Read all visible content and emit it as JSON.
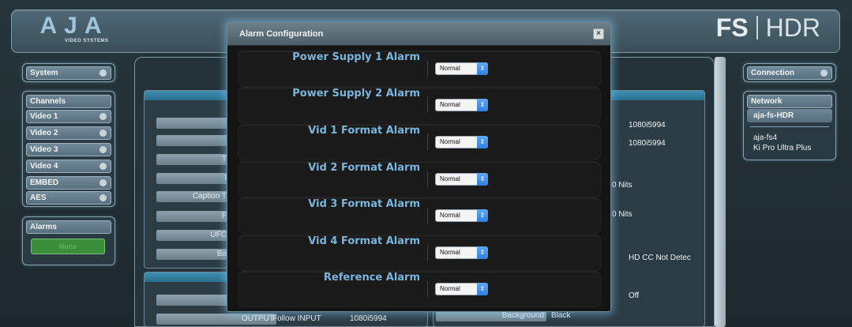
{
  "brand": {
    "logo": "AJA",
    "logo_sub": "VIDEO SYSTEMS",
    "product_main": "FS",
    "product_sub": "HDR"
  },
  "left_sidebar": {
    "system": "System",
    "channels_header": "Channels",
    "channels": [
      "Video 1",
      "Video 2",
      "Video 3",
      "Video 4",
      "EMBED",
      "AES"
    ],
    "alarms_header": "Alarms",
    "alarms_status": "None"
  },
  "right_sidebar": {
    "connection": "Connection",
    "network_header": "Network",
    "network_items": [
      "aja-fs-HDR",
      "aja-fs4",
      "Ki Pro Ultra Plus"
    ]
  },
  "background": {
    "left_rows": [
      "",
      "",
      "T",
      "I",
      "Caption T",
      "F",
      "UFC",
      "Ba"
    ],
    "right_values": [
      "1080i5994",
      "1080i5994",
      "0 Nits",
      "0 Nits",
      "HD CC Not Detec",
      "Off"
    ],
    "bottom_left_label": "OUTPUT",
    "bottom_left_value": "Follow INPUT",
    "bottom_left_format": "1080i5994",
    "bottom_right_label": "Background",
    "bottom_right_value": "Black"
  },
  "modal": {
    "title": "Alarm Configuration",
    "close_label": "×",
    "rows": [
      {
        "label": "Power Supply 1 Alarm",
        "value": "Normal"
      },
      {
        "label": "Power Supply 2 Alarm",
        "value": "Normal"
      },
      {
        "label": "Vid 1 Format Alarm",
        "value": "Normal"
      },
      {
        "label": "Vid 2 Format Alarm",
        "value": "Normal"
      },
      {
        "label": "Vid 3 Format Alarm",
        "value": "Normal"
      },
      {
        "label": "Vid 4 Format Alarm",
        "value": "Normal"
      },
      {
        "label": "Reference Alarm",
        "value": "Normal"
      }
    ]
  }
}
